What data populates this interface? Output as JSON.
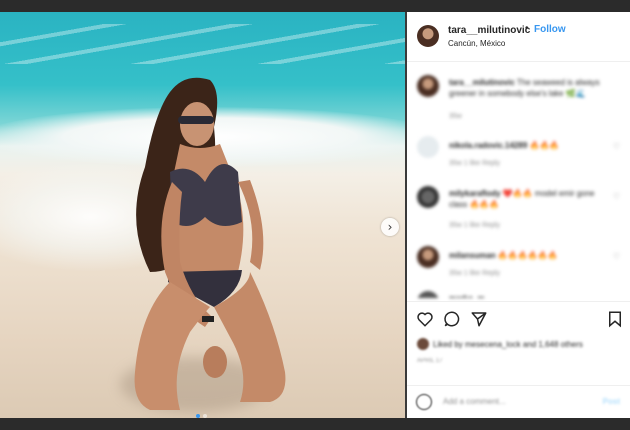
{
  "header": {
    "username": "tara__milutinovic",
    "separator": "•",
    "follow_label": "Follow",
    "location": "Cancún, México"
  },
  "photo": {
    "next_arrow": "›",
    "carousel_total": 2,
    "carousel_active": 1
  },
  "comments": [
    {
      "user": "tara__milutinovic",
      "text": "The seaweed is always greener in somebody else's lake 🌿🌊",
      "meta": "35w",
      "is_caption": true
    },
    {
      "user": "nikola.radovic.14289",
      "text": "🔥🔥🔥",
      "meta": "35w   1 like   Reply"
    },
    {
      "user": "milykaraflody",
      "text": "❤️🔥🔥 model emir gone class 🔥🔥🔥",
      "meta": "35w   1 like   Reply"
    },
    {
      "user": "milansuman",
      "text": "🔥🔥🔥🔥🔥🔥",
      "meta": "35w   1 like   Reply"
    },
    {
      "user": "marko_m",
      "text": "...",
      "meta": ""
    }
  ],
  "actions": {
    "liked_by": "Liked by mesecena_lock and 1,648 others",
    "date": "APRIL 17"
  },
  "add_comment": {
    "placeholder": "Add a comment...",
    "post_label": "Post"
  },
  "colors": {
    "accent": "#3897f0",
    "text": "#262626",
    "muted": "#8e8e8e"
  }
}
